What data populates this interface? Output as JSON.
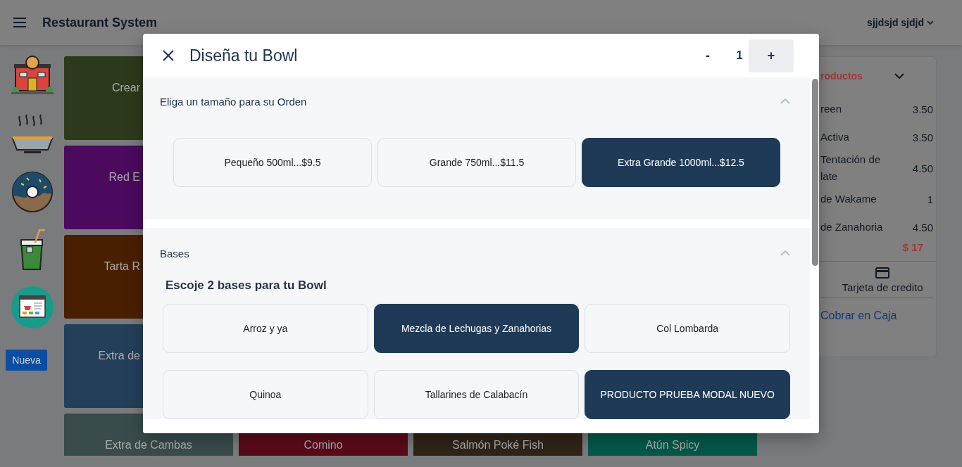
{
  "header": {
    "title": "Restaurant System",
    "user": "sjjdsjd sjdjd"
  },
  "new_button": "Nueva",
  "tiles": [
    {
      "label": "Crear",
      "color": "#2c3a1b"
    },
    {
      "label": "Red E",
      "color": "#4b0a5e"
    },
    {
      "label": "Tarta R",
      "color": "#4a1f00"
    },
    {
      "label": "Extra de",
      "color": "#243f5a"
    },
    {
      "label": "Extra de Cambas",
      "color": "#394b4b"
    },
    {
      "label": "Comino",
      "color": "#5a0a1a"
    },
    {
      "label": "Salmón Poké Fish",
      "color": "#302418"
    },
    {
      "label": "Atún Spicy",
      "color": "#03594a"
    }
  ],
  "order_panel": {
    "title": "roductos",
    "items": [
      {
        "name": "reen",
        "price": "3.50"
      },
      {
        "name": "Activa",
        "price": "3.50"
      },
      {
        "name": "Tentación de late",
        "price": "4.50"
      },
      {
        "name": "de Wakame",
        "price": "1"
      },
      {
        "name": "de Zanahoria",
        "price": "4.50"
      }
    ],
    "total": "$ 17",
    "payment": "Tarjeta de credito",
    "checkout": "Cobrar en Caja"
  },
  "modal": {
    "title": "Diseña tu Bowl",
    "minus": "-",
    "quantity": "1",
    "plus": "+",
    "sections": [
      {
        "title": "Eliga un tamaño para su Orden",
        "expanded": true,
        "options": [
          {
            "label": "Pequeño 500ml...$9.5",
            "selected": false
          },
          {
            "label": "Grande 750ml...$11.5",
            "selected": false
          },
          {
            "label": "Extra Grande 1000ml...$12.5",
            "selected": true
          }
        ]
      },
      {
        "title": "Bases",
        "expanded": true,
        "heading": "Escoje 2 bases para tu Bowl",
        "options": [
          {
            "label": "Arroz y ya",
            "selected": false
          },
          {
            "label": "Mezcla de Lechugas y Zanahorias",
            "selected": true
          },
          {
            "label": "Col Lombarda",
            "selected": false
          },
          {
            "label": "Quinoa",
            "selected": false
          },
          {
            "label": "Tallarines de Calabacín",
            "selected": false
          },
          {
            "label": "PRODUCTO PRUEBA MODAL NUEVO",
            "selected": true
          }
        ]
      }
    ]
  }
}
